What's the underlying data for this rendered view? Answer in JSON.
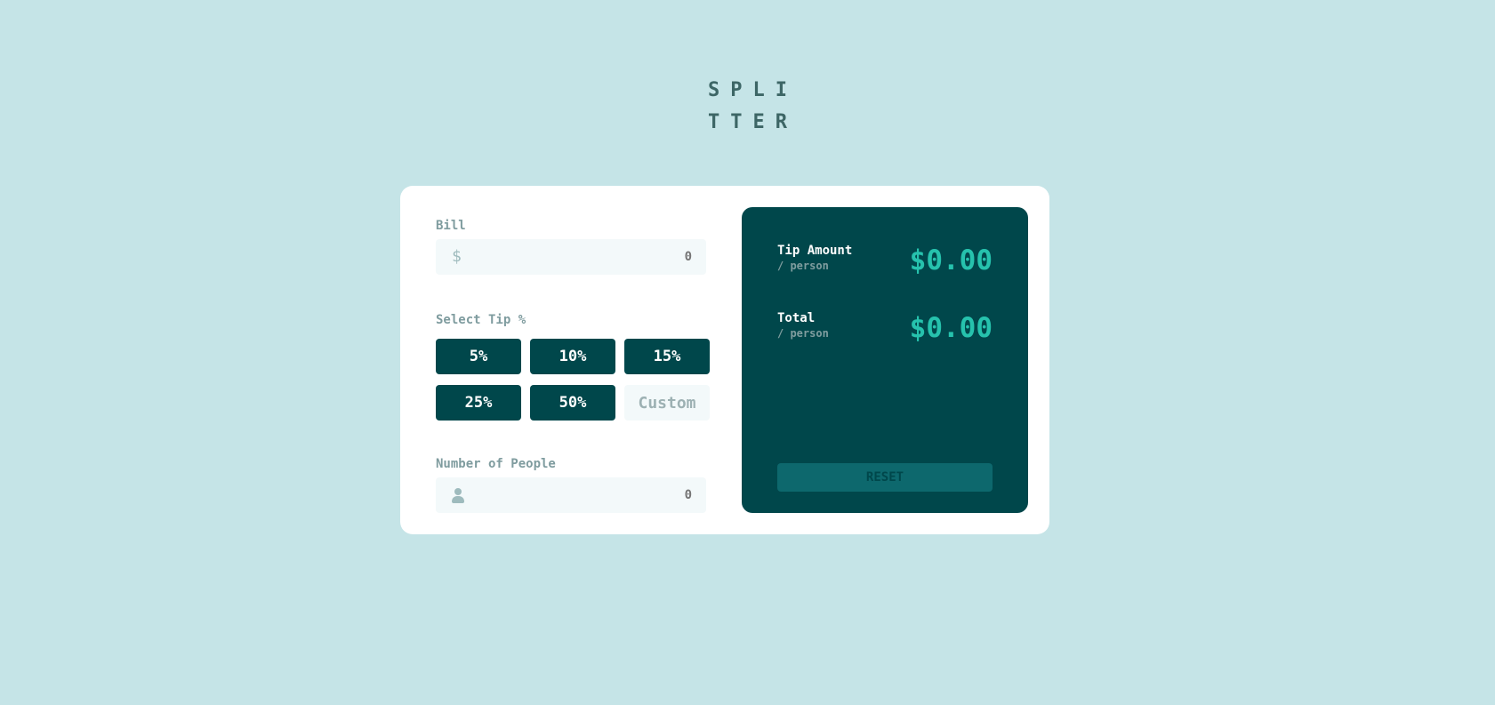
{
  "logo": {
    "line1": "SPLI",
    "line2": "TTER"
  },
  "calculator": {
    "bill": {
      "label": "Bill",
      "icon": "dollar-icon",
      "currency_symbol": "$",
      "placeholder": "0"
    },
    "tip": {
      "label": "Select Tip %",
      "options": [
        "5%",
        "10%",
        "15%",
        "25%",
        "50%"
      ],
      "custom_placeholder": "Custom"
    },
    "people": {
      "label": "Number of People",
      "icon": "person-icon",
      "placeholder": "0"
    }
  },
  "results": {
    "tip_amount": {
      "label": "Tip Amount",
      "sub": "/ person",
      "value": "$0.00"
    },
    "total": {
      "label": "Total",
      "sub": "/ person",
      "value": "$0.00"
    },
    "reset_label": "RESET"
  },
  "colors": {
    "background": "#c5e4e7",
    "dark_cyan": "#00474b",
    "strong_cyan": "#26c2ad",
    "reset_disabled": "#0d686d",
    "input_bg": "#f3f9fa"
  }
}
